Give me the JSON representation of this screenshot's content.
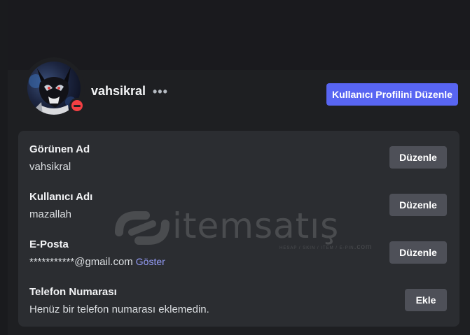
{
  "profile": {
    "username": "vahsikral",
    "more_glyph": "•••",
    "edit_profile_label": "Kullanıcı Profilini Düzenle",
    "status": "do-not-disturb"
  },
  "watermark": {
    "brand": "itemsatış",
    "tagline": "HESAP / SKIN / ITEM / E-PIN",
    "suffix": ".com"
  },
  "fields": [
    {
      "label": "Görünen Ad",
      "value": "vahsikral",
      "button": "Düzenle"
    },
    {
      "label": "Kullanıcı Adı",
      "value": "mazallah",
      "button": "Düzenle"
    },
    {
      "label": "E-Posta",
      "value": "***********@gmail.com",
      "reveal": "Göster",
      "button": "Düzenle"
    },
    {
      "label": "Telefon Numarası",
      "value": "Henüz bir telefon numarası eklemedin.",
      "button": "Ekle"
    }
  ],
  "colors": {
    "background": "#1e1f22",
    "panel": "#2b2d31",
    "accent": "#5865f2",
    "secondary_button": "#4e5058",
    "link": "#949cf7",
    "status_dnd": "#f23f43"
  }
}
